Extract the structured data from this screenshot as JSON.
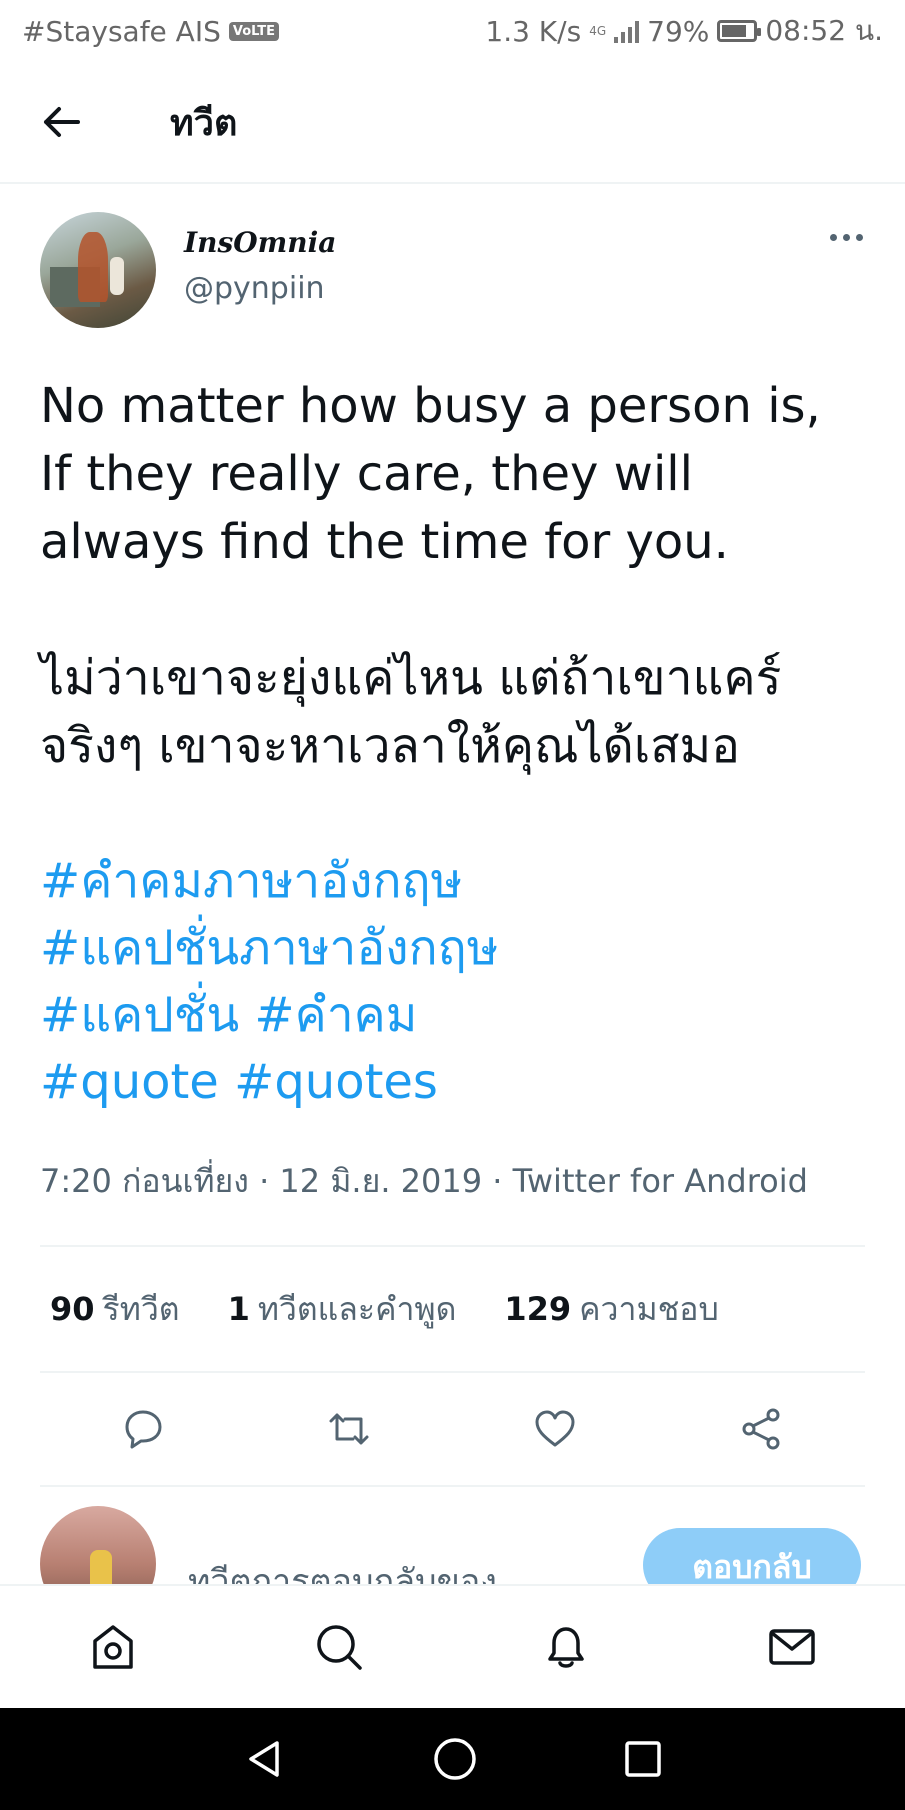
{
  "status_bar": {
    "carrier": "#Staysafe AIS",
    "volte": "VoLTE",
    "speed": "1.3 K/s",
    "network": "4G",
    "battery": "79%",
    "battery_level": 0.79,
    "time": "08:52 น."
  },
  "header": {
    "title": "ทวีต"
  },
  "tweet": {
    "display_name": "InsOmnia",
    "handle": "@pynpiin",
    "text_en": [
      "No matter how busy a person is,",
      "If they really care, they will",
      "always find the time for you."
    ],
    "text_th": [
      "ไม่ว่าเขาจะยุ่งแค่ไหน แต่ถ้าเขาแคร์",
      "จริงๆ เขาจะหาเวลาให้คุณได้เสมอ"
    ],
    "hashtags": [
      "#คำคมภาษาอังกฤษ",
      "#แคปชั่นภาษาอังกฤษ",
      "#แคปชั่น",
      "#คำคม",
      "#quote",
      "#quotes"
    ],
    "meta": "7:20 ก่อนเที่ยง · 12 มิ.ย. 2019 · Twitter for Android",
    "stats": {
      "retweets_count": "90",
      "retweets_label": "รีทวีต",
      "quotes_count": "1",
      "quotes_label": "ทวีตและคำพูด",
      "likes_count": "129",
      "likes_label": "ความชอบ"
    }
  },
  "reply": {
    "placeholder": "ทวีตการตอบกลับของ",
    "button_label": "ตอบกลับ"
  },
  "icons": {
    "back": "arrow-left-icon",
    "more": "more-horizontal-icon",
    "reply": "speech-bubble-icon",
    "retweet": "retweet-icon",
    "like": "heart-icon",
    "share": "share-icon",
    "home": "home-icon",
    "search": "search-icon",
    "notifications": "bell-icon",
    "messages": "mail-icon"
  },
  "colors": {
    "accent": "#1d9bf0",
    "reply_button": "#8ecdf8",
    "secondary_text": "#536471"
  }
}
